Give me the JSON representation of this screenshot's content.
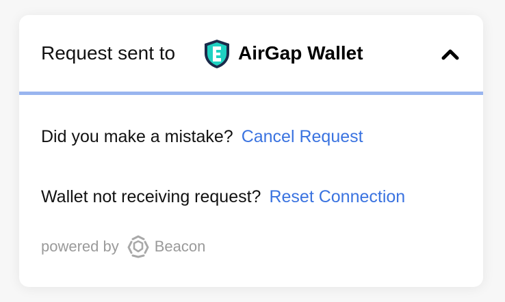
{
  "header": {
    "prefix": "Request sent to",
    "wallet_name": "AirGap Wallet",
    "wallet_icon": "airgap-shield-icon",
    "toggle_icon": "chevron-up-icon"
  },
  "colors": {
    "divider": "#99b5ef",
    "link": "#3a73e0",
    "wallet_icon_fill": "#1fd1c2"
  },
  "body": {
    "mistake_text": "Did you make a mistake?",
    "cancel_link": "Cancel Request",
    "not_receiving_text": "Wallet not receiving request?",
    "reset_link": "Reset Connection"
  },
  "footer": {
    "powered_by": "powered by",
    "brand_icon": "beacon-icon",
    "brand_name": "Beacon"
  }
}
